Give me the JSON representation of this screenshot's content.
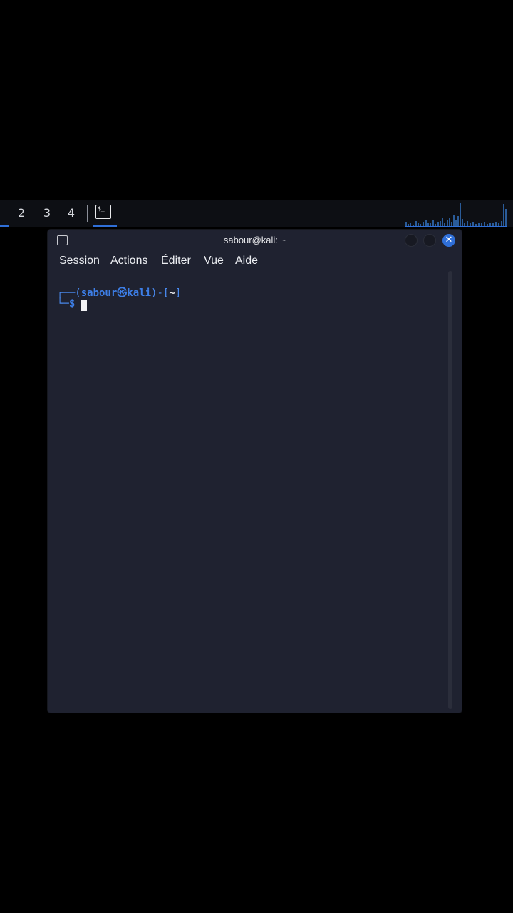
{
  "taskbar": {
    "workspaces": [
      "2",
      "3",
      "4"
    ],
    "active_task_icon": "terminal-icon",
    "accent_color": "#2f6fd8",
    "cpu_graph_color": "#3d8ef0"
  },
  "window": {
    "title": "sabour@kali: ~",
    "close_glyph": "✕",
    "menu": [
      "Session",
      "Actions",
      "Éditer",
      "Vue",
      "Aide"
    ]
  },
  "terminal": {
    "prompt_top_left": "┌──(",
    "user": "sabour",
    "at_symbol": "㉿",
    "host": "kali",
    "mid": ")-[",
    "path": "~",
    "end": "]",
    "prompt_bottom_left": "└─",
    "dollar": "$"
  },
  "colors": {
    "background": "#000000",
    "window_bg": "#1f2230",
    "prompt_blue": "#3d7fe8"
  }
}
